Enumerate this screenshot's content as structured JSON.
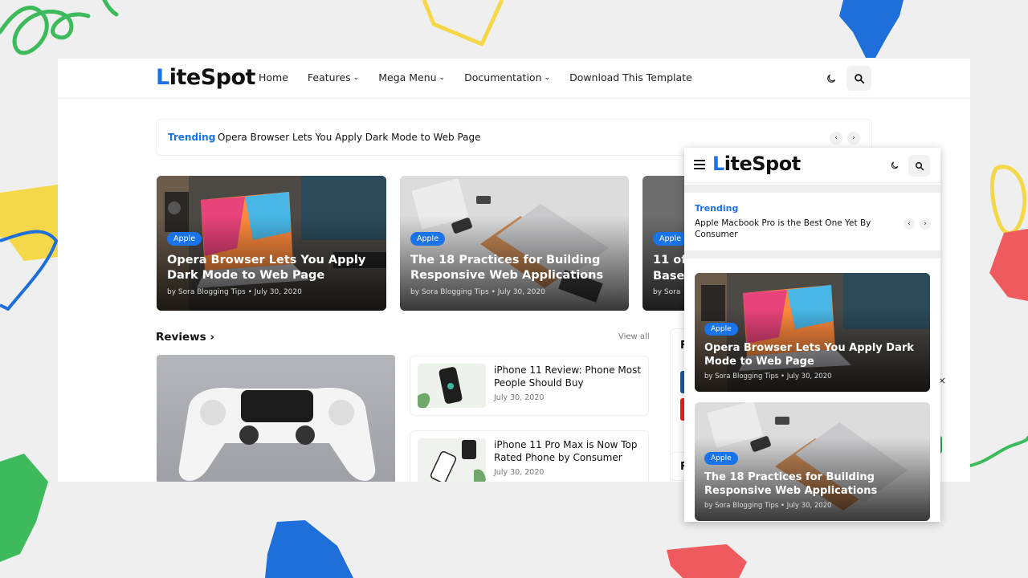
{
  "colors": {
    "accent": "#1a73e8",
    "deco_green": "#3dbb5c",
    "deco_blue": "#1e6fd9",
    "deco_yellow": "#f4d84a",
    "deco_red": "#ef5a5e"
  },
  "desktop": {
    "logo": {
      "first": "L",
      "rest": "iteSpot"
    },
    "nav": [
      {
        "label": "Home",
        "dropdown": false
      },
      {
        "label": "Features",
        "dropdown": true
      },
      {
        "label": "Mega Menu",
        "dropdown": true
      },
      {
        "label": "Documentation",
        "dropdown": true
      },
      {
        "label": "Download This Template",
        "dropdown": false
      }
    ],
    "icons": {
      "theme": "moon-icon",
      "search": "search-icon"
    },
    "trending": {
      "label": "Trending",
      "text": "Opera Browser Lets You Apply Dark Mode to Web Page",
      "prev": "‹",
      "next": "›"
    },
    "featured": [
      {
        "badge": "Apple",
        "title": "Opera Browser Lets You Apply Dark Mode to Web Page",
        "meta": "by Sora Blogging Tips • July 30, 2020"
      },
      {
        "badge": "Apple",
        "title": "The 18 Practices for Building Responsive Web Applications",
        "meta": "by Sora Blogging Tips • July 30, 2020"
      },
      {
        "badge": "Apple",
        "title": "11 of ... Base...",
        "title_line1": "11 of",
        "title_line2": "Base",
        "meta": "by Sora"
      }
    ],
    "reviews": {
      "title": "Reviews ›",
      "view_all": "View all",
      "items": [
        {
          "title": "iPhone 11 Review: Phone Most People Should Buy",
          "date": "July 30, 2020"
        },
        {
          "title": "iPhone 11 Pro Max is Now Top Rated Phone by Consumer",
          "date": "July 30, 2020"
        }
      ]
    },
    "sidebar_peek": {
      "letter1": "F",
      "letter2": "F",
      "close": "×"
    }
  },
  "mobile": {
    "logo": {
      "first": "L",
      "rest": "iteSpot"
    },
    "menu_icon": "menu-icon",
    "trending": {
      "label": "Trending",
      "text": "Apple Macbook Pro is the Best One Yet By Consumer",
      "prev": "‹",
      "next": "›"
    },
    "posts": [
      {
        "badge": "Apple",
        "title": "Opera Browser Lets You Apply Dark Mode to Web Page",
        "meta": "by Sora Blogging Tips • July 30, 2020"
      },
      {
        "badge": "Apple",
        "title": "The 18 Practices for Building Responsive Web Applications",
        "meta": "by Sora Blogging Tips • July 30, 2020"
      }
    ]
  }
}
